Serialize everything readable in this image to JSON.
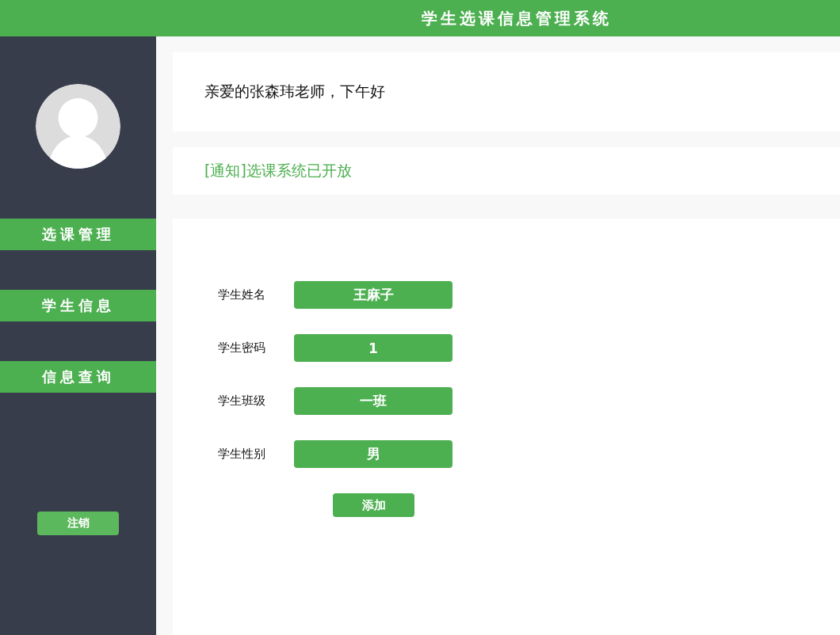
{
  "header": {
    "title": "学生选课信息管理系统"
  },
  "sidebar": {
    "items": [
      {
        "label": "选课管理"
      },
      {
        "label": "学生信息"
      },
      {
        "label": "信息查询"
      }
    ],
    "logout": "注销"
  },
  "greeting": "亲爱的张森玮老师，下午好",
  "notice": "[通知]选课系统已开放",
  "form": {
    "fields": [
      {
        "label": "学生姓名",
        "value": "王麻子"
      },
      {
        "label": "学生密码",
        "value": "1"
      },
      {
        "label": "学生班级",
        "value": "一班"
      },
      {
        "label": "学生性别",
        "value": "男"
      }
    ],
    "submit": "添加"
  }
}
